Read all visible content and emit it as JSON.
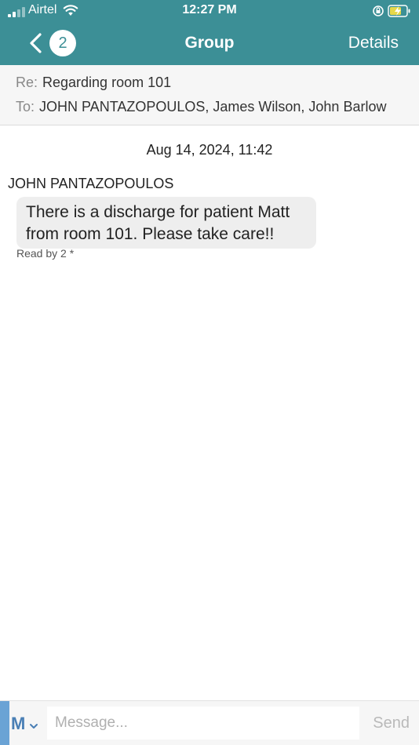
{
  "status_bar": {
    "carrier": "Airtel",
    "time": "12:27 PM"
  },
  "nav": {
    "back_count": "2",
    "title": "Group",
    "details_label": "Details"
  },
  "header": {
    "re_label": "Re:",
    "subject": "Regarding room 101",
    "to_label": "To:",
    "recipients": "JOHN PANTAZOPOULOS, James Wilson, John Barlow"
  },
  "thread": {
    "date": "Aug 14, 2024, 11:42",
    "messages": [
      {
        "sender": "JOHN PANTAZOPOULOS",
        "text": "There is a discharge for patient Matt from room 101. Please take care!!",
        "read_status": "Read by 2 *"
      }
    ]
  },
  "compose": {
    "format_label": "M",
    "placeholder": "Message...",
    "send_label": "Send"
  },
  "colors": {
    "header_teal": "#3c8f96",
    "bubble_bg": "#eeeeee",
    "accent_blue": "#4a7fb5"
  }
}
